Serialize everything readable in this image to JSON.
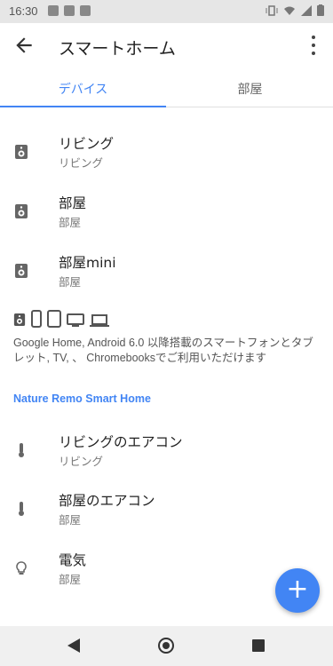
{
  "status_bar": {
    "time": "16:30"
  },
  "header": {
    "title": "スマートホーム"
  },
  "tabs": [
    {
      "label": "デバイス",
      "active": true
    },
    {
      "label": "部屋",
      "active": false
    }
  ],
  "devices": [
    {
      "name": "リビング",
      "room": "リビング",
      "icon": "speaker-icon"
    },
    {
      "name": "部屋",
      "room": "部屋",
      "icon": "speaker-icon"
    },
    {
      "name": "部屋mini",
      "room": "部屋",
      "icon": "speaker-icon"
    }
  ],
  "supported_note": "Google Home, Android 6.0 以降搭載のスマートフォンとタブレット, TV, 、 Chromebooksでご利用いただけます",
  "section_title": "Nature Remo Smart Home",
  "remo_devices": [
    {
      "name": "リビングのエアコン",
      "room": "リビング",
      "icon": "thermometer-icon"
    },
    {
      "name": "部屋のエアコン",
      "room": "部屋",
      "icon": "thermometer-icon"
    },
    {
      "name": "電気",
      "room": "部屋",
      "icon": "lightbulb-icon"
    }
  ],
  "fab": {
    "symbol": "+"
  },
  "colors": {
    "accent": "#4285f4",
    "status_bar": "#e6e6e6"
  }
}
